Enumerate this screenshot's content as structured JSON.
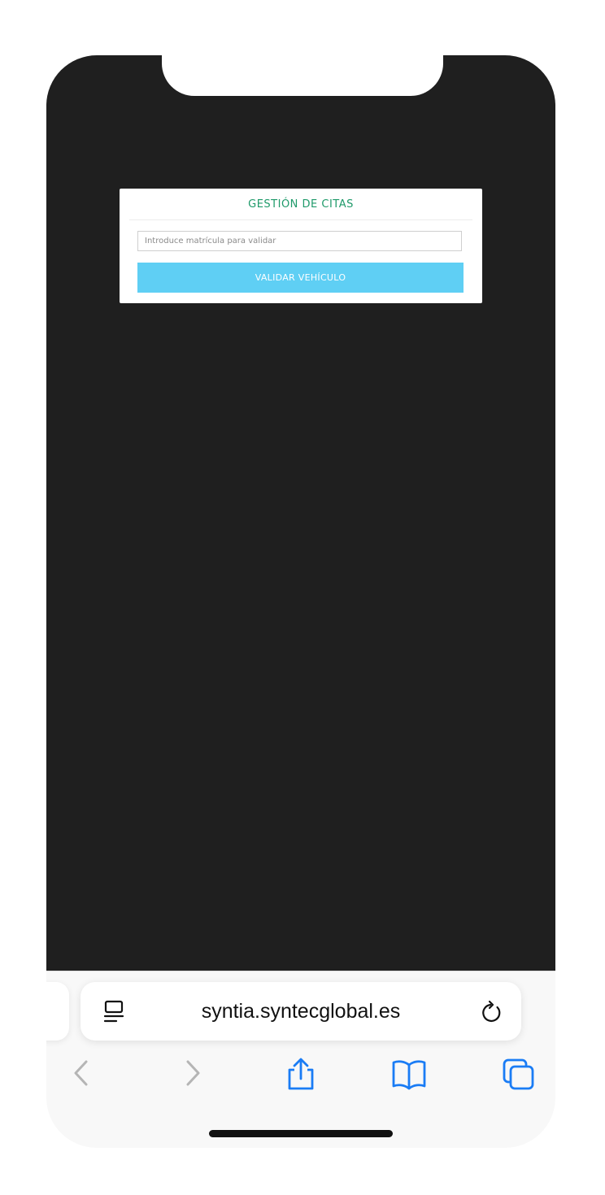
{
  "app": {
    "title": "GESTIÓN DE CITAS",
    "input_placeholder": "Introduce matrícula para validar",
    "input_value": "",
    "button_label": "VALIDAR VEHÍCULO"
  },
  "browser": {
    "url": "syntia.syntecglobal.es",
    "icons": {
      "reader": "reader-mode-icon",
      "reload": "reload-icon",
      "back": "back-chevron-icon",
      "forward": "forward-chevron-icon",
      "share": "share-icon",
      "bookmarks": "bookmarks-book-icon",
      "tabs": "tabs-icon"
    }
  },
  "colors": {
    "title_green": "#1f9a6a",
    "button_blue": "#5fcff4",
    "page_background": "#1f1f1f",
    "ios_blue": "#1a7cf5",
    "disabled_grey": "#b5b5b5"
  }
}
